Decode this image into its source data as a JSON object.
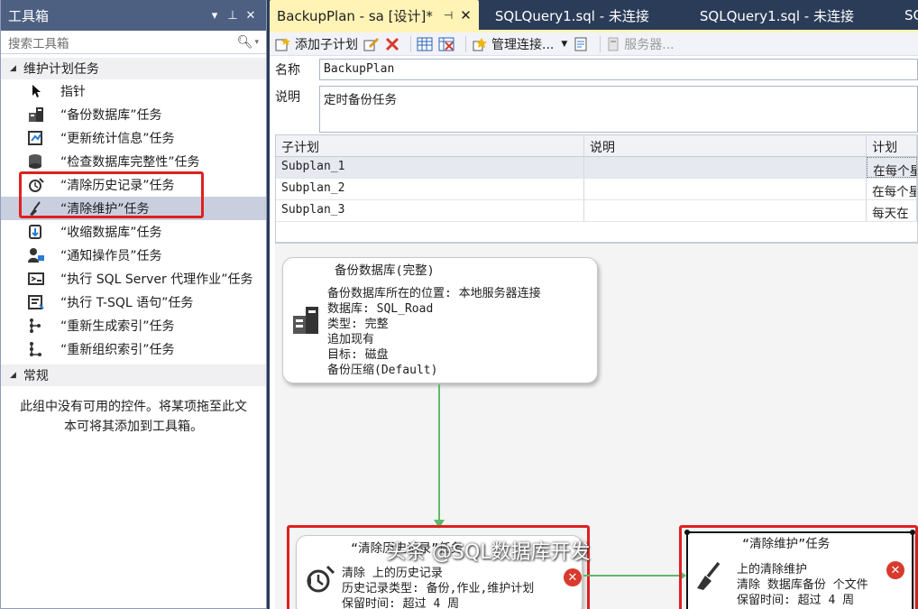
{
  "toolbox": {
    "title": "工具箱",
    "search_placeholder": "搜索工具箱",
    "group_maintenance": "维护计划任务",
    "items": [
      {
        "label": "指针",
        "icon": "pointer-icon"
      },
      {
        "label": "“备份数据库”任务",
        "icon": "backup-database-icon"
      },
      {
        "label": "“更新统计信息”任务",
        "icon": "update-statistics-icon"
      },
      {
        "label": "“检查数据库完整性”任务",
        "icon": "check-integrity-icon"
      },
      {
        "label": "“清除历史记录”任务",
        "icon": "history-cleanup-icon"
      },
      {
        "label": "“清除维护”任务",
        "icon": "maintenance-cleanup-icon"
      },
      {
        "label": "“收缩数据库”任务",
        "icon": "shrink-database-icon"
      },
      {
        "label": "“通知操作员”任务",
        "icon": "notify-operator-icon"
      },
      {
        "label": "“执行 SQL Server 代理作业”任务",
        "icon": "agent-job-icon"
      },
      {
        "label": "“执行 T-SQL 语句”任务",
        "icon": "tsql-icon"
      },
      {
        "label": "“重新生成索引”任务",
        "icon": "rebuild-index-icon"
      },
      {
        "label": "“重新组织索引”任务",
        "icon": "reorganize-index-icon"
      }
    ],
    "group_general": "常规",
    "general_note": "此组中没有可用的控件。将某项拖至此文本可将其添加到工具箱。"
  },
  "tabs": [
    {
      "label": "BackupPlan - sa [设计]*",
      "active": true
    },
    {
      "label": "SQLQuery1.sql - 未连接",
      "active": false
    },
    {
      "label": "SQLQuery1.sql - 未连接",
      "active": false
    },
    {
      "label": "SQ",
      "active": false
    }
  ],
  "toolbar": {
    "add_subplan": "添加子计划",
    "manage_connections": "管理连接...",
    "servers": "服务器..."
  },
  "properties": {
    "name_label": "名称",
    "name_value": "BackupPlan",
    "desc_label": "说明",
    "desc_value": "定时备份任务"
  },
  "subplan_grid": {
    "headers": [
      "子计划",
      "说明",
      "计划"
    ],
    "rows": [
      [
        "Subplan_1",
        "",
        "在每个星"
      ],
      [
        "Subplan_2",
        "",
        "在每个星"
      ],
      [
        "Subplan_3",
        "",
        "每天在"
      ]
    ]
  },
  "tasks": {
    "backup": {
      "title": "备份数据库(完整)",
      "lines": [
        "备份数据库所在的位置: 本地服务器连接",
        "数据库: SQL_Road",
        "类型: 完整",
        "追加现有",
        "目标: 磁盘",
        "备份压缩(Default)"
      ]
    },
    "history": {
      "title": "“清除历史记录”任务",
      "lines": [
        "清除  上的历史记录",
        "历史记录类型: 备份,作业,维护计划",
        "保留时间: 超过 4 周"
      ]
    },
    "maint": {
      "title": "“清除维护”任务",
      "lines": [
        "上的清除维护",
        "清除 数据库备份 个文件",
        "保留时间: 超过 4 周"
      ]
    }
  },
  "watermark": "头条 @SQL数据库开发",
  "colors": {
    "accent_red": "#e02020",
    "connector_green": "#5cba6b",
    "active_tab": "#fff3b6",
    "dark_chrome": "#2b3c59"
  }
}
